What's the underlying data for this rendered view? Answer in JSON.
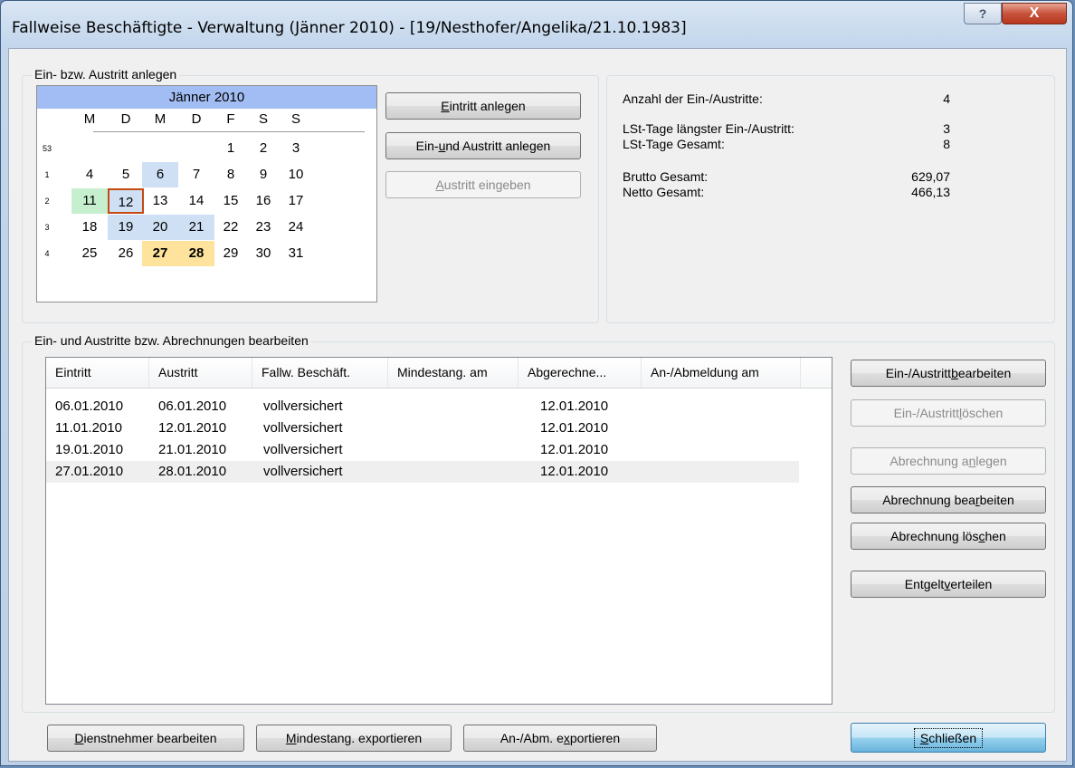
{
  "window": {
    "title": "Fallweise Beschäftigte - Verwaltung (Jänner 2010) - [19/Nesthofer/Angelika/21.10.1983]",
    "help_glyph": "?",
    "close_glyph": "X"
  },
  "entry_group": {
    "label": "Ein- bzw. Austritt anlegen",
    "calendar": {
      "month_label": "Jänner 2010",
      "weekdays": [
        "M",
        "D",
        "M",
        "D",
        "F",
        "S",
        "S"
      ],
      "weeks": [
        {
          "number": "53",
          "days": [
            "",
            "",
            "",
            "",
            "1",
            "2",
            "3"
          ]
        },
        {
          "number": "1",
          "days": [
            "4",
            "5",
            "6",
            "7",
            "8",
            "9",
            "10"
          ]
        },
        {
          "number": "2",
          "days": [
            "11",
            "12",
            "13",
            "14",
            "15",
            "16",
            "17"
          ]
        },
        {
          "number": "3",
          "days": [
            "18",
            "19",
            "20",
            "21",
            "22",
            "23",
            "24"
          ]
        },
        {
          "number": "4",
          "days": [
            "25",
            "26",
            "27",
            "28",
            "29",
            "30",
            "31"
          ]
        }
      ]
    },
    "buttons": {
      "eintritt_anlegen": {
        "prefix": "",
        "accel": "E",
        "suffix": "intritt anlegen"
      },
      "ein_und_austritt_anlegen": {
        "prefix": "Ein- ",
        "accel": "u",
        "suffix": "nd Austritt anlegen"
      },
      "austritt_eingeben": {
        "prefix": "",
        "accel": "A",
        "suffix": "ustritt eingeben"
      }
    }
  },
  "stats": {
    "count_label": "Anzahl der Ein-/Austritte:",
    "count_value": "4",
    "longest_label": "LSt-Tage längster Ein-/Austritt:",
    "longest_value": "3",
    "total_days_label": "LSt-Tage Gesamt:",
    "total_days_value": "8",
    "brutto_label": "Brutto Gesamt:",
    "brutto_value": "629,07",
    "netto_label": "Netto Gesamt:",
    "netto_value": "466,13"
  },
  "edit_group": {
    "label": "Ein- und Austritte bzw. Abrechnungen bearbeiten",
    "columns": [
      "Eintritt",
      "Austritt",
      "Fallw. Beschäft.",
      "Mindestang. am",
      "Abgerechne...",
      "An-/Abmeldung am"
    ],
    "rows": [
      {
        "eintritt": "06.01.2010",
        "austritt": "06.01.2010",
        "fallw": "vollversichert",
        "mindestang": "",
        "abgerechnet": "12.01.2010",
        "anmeldung": ""
      },
      {
        "eintritt": "11.01.2010",
        "austritt": "12.01.2010",
        "fallw": "vollversichert",
        "mindestang": "",
        "abgerechnet": "12.01.2010",
        "anmeldung": ""
      },
      {
        "eintritt": "19.01.2010",
        "austritt": "21.01.2010",
        "fallw": "vollversichert",
        "mindestang": "",
        "abgerechnet": "12.01.2010",
        "anmeldung": ""
      },
      {
        "eintritt": "27.01.2010",
        "austritt": "28.01.2010",
        "fallw": "vollversichert",
        "mindestang": "",
        "abgerechnet": "12.01.2010",
        "anmeldung": ""
      }
    ],
    "buttons": {
      "austritt_bearbeiten": {
        "prefix": "Ein-/Austritt ",
        "accel": "b",
        "suffix": "earbeiten"
      },
      "austritt_loeschen": {
        "prefix": "Ein-/Austritt ",
        "accel": "l",
        "suffix": "öschen"
      },
      "abrechnung_anlegen": {
        "prefix": "Abrechnung a",
        "accel": "n",
        "suffix": "legen"
      },
      "abrechnung_bearbeiten": {
        "prefix": "Abrechnung bea",
        "accel": "r",
        "suffix": "beiten"
      },
      "abrechnung_loeschen": {
        "prefix": "Abrechnung lös",
        "accel": "c",
        "suffix": "hen"
      },
      "entgelt_verteilen": {
        "prefix": "Entgelt ",
        "accel": "v",
        "suffix": "erteilen"
      }
    }
  },
  "footer": {
    "dienstnehmer": {
      "prefix": "",
      "accel": "D",
      "suffix": "ienstnehmer bearbeiten"
    },
    "mindestang_export": {
      "prefix": "",
      "accel": "M",
      "suffix": "indestang. exportieren"
    },
    "anabm_export": {
      "prefix": "An-/Abm. e",
      "accel": "x",
      "suffix": "portieren"
    },
    "schliessen": {
      "prefix": "",
      "accel": "S",
      "suffix": "chließen"
    }
  },
  "colors": {
    "calendar_header": "#a2bdf3",
    "range_blue": "#cfe0f5",
    "range_green": "#c6efcf",
    "range_yellow": "#fde39c",
    "today_border": "#c44a12"
  }
}
